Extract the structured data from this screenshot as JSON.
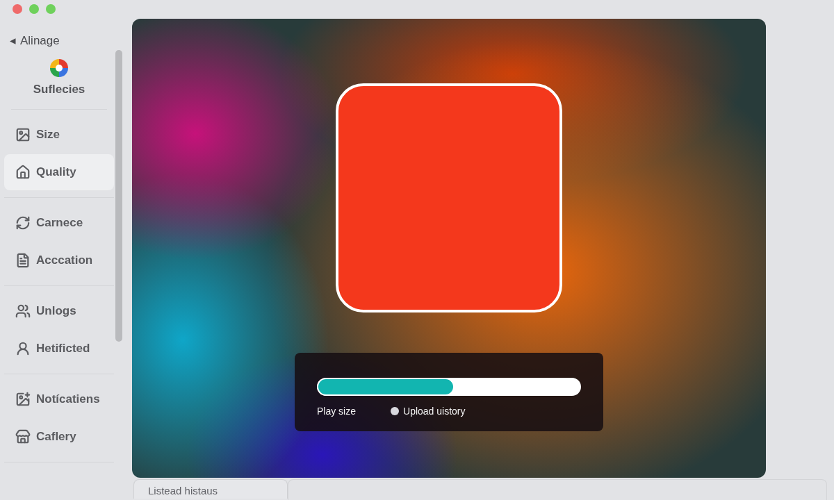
{
  "sidebar": {
    "back": {
      "glyph": "◂",
      "label": "Alinage"
    },
    "account": {
      "name": "Suflecies"
    },
    "groups": [
      [
        {
          "label": "Size",
          "selected": false
        },
        {
          "label": "Quality",
          "selected": true
        }
      ],
      [
        {
          "label": "Carnece",
          "selected": false
        },
        {
          "label": "Acccation",
          "selected": false
        }
      ],
      [
        {
          "label": "Unlogs",
          "selected": false
        },
        {
          "label": "Hetificted",
          "selected": false
        }
      ],
      [
        {
          "label": "Notícatiens",
          "selected": false
        },
        {
          "label": "Caflery",
          "selected": false
        }
      ]
    ]
  },
  "preview": {
    "progress": {
      "level": 0.52,
      "label": "Play size",
      "option": "Upload uistory"
    }
  },
  "bottom_tab": {
    "label": "Listead histaus"
  }
}
